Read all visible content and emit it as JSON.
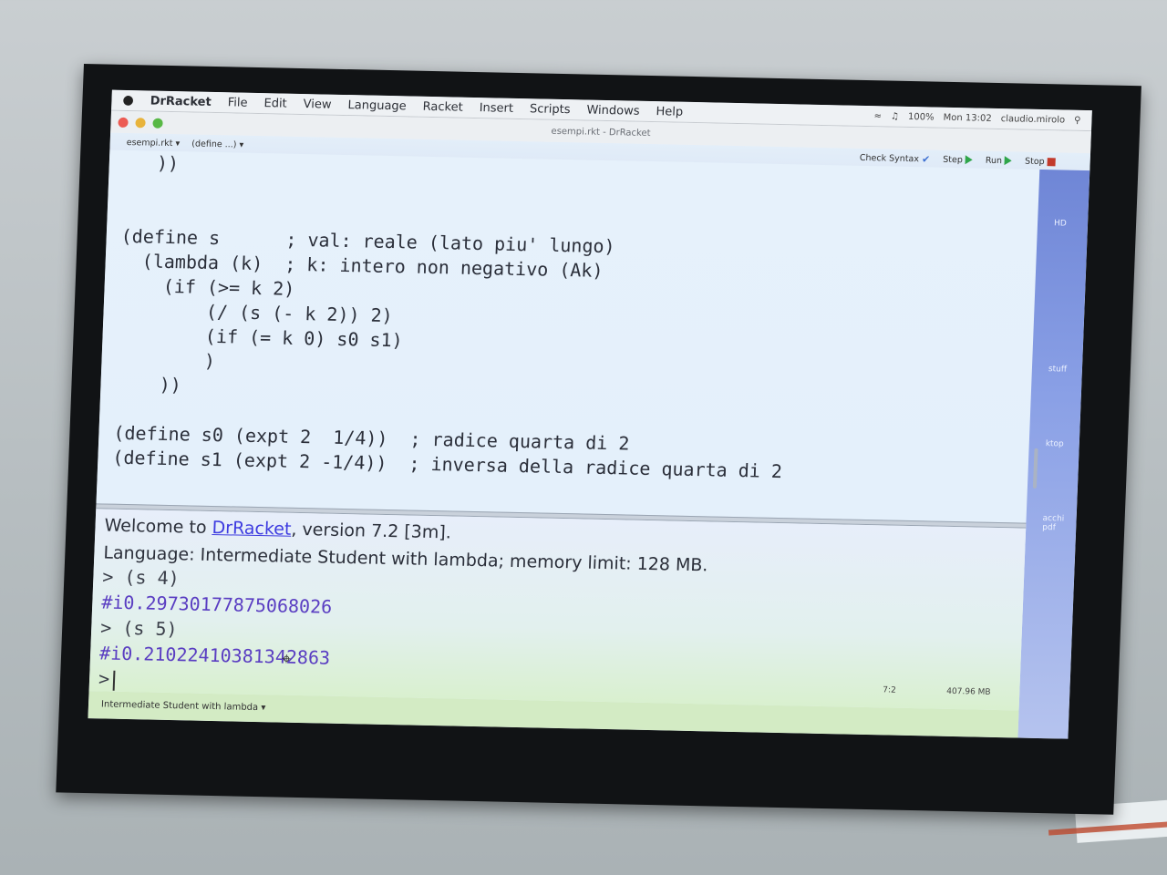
{
  "menubar": {
    "apple": "",
    "app_name": "DrRacket",
    "items": [
      "File",
      "Edit",
      "View",
      "Language",
      "Racket",
      "Insert",
      "Scripts",
      "Windows",
      "Help"
    ],
    "status": {
      "battery": "100%",
      "clock": "Mon 13:02",
      "user": "claudio.mirolo"
    }
  },
  "window": {
    "title": "esempi.rkt - DrRacket",
    "file_dropdown": "esempi.rkt ▾",
    "define_dropdown": "(define ...) ▾"
  },
  "toolbar": {
    "check_syntax": "Check Syntax",
    "step": "Step",
    "run": "Run",
    "stop": "Stop"
  },
  "editor": {
    "lines": [
      "   ))",
      "",
      "",
      "(define s      ; val: reale (lato piu' lungo)",
      "  (lambda (k)  ; k: intero non negativo (Ak)",
      "    (if (>= k 2)",
      "        (/ (s (- k 2)) 2)",
      "        (if (= k 0) s0 s1)",
      "        )",
      "    ))",
      "",
      "(define s0 (expt 2  1/4))  ; radice quarta di 2",
      "(define s1 (expt 2 -1/4))  ; inversa della radice quarta di 2"
    ]
  },
  "repl": {
    "welcome_prefix": "Welcome to ",
    "welcome_link": "DrRacket",
    "welcome_suffix": ", version 7.2 [3m].",
    "language_line": "Language: Intermediate Student with lambda; memory limit: 128 MB.",
    "interactions": [
      {
        "input": "> (s 4)",
        "output": "#i0.29730177875068026"
      },
      {
        "input": "> (s 5)",
        "output": "#i0.21022410381342863"
      }
    ],
    "prompt": ">",
    "position": "7:2",
    "memory": "407.96 MB"
  },
  "statusbar": {
    "language": "Intermediate Student with lambda ▾"
  },
  "desktop": {
    "labels": [
      "HD",
      "stuff",
      "ktop",
      "acchi\npdf"
    ]
  }
}
